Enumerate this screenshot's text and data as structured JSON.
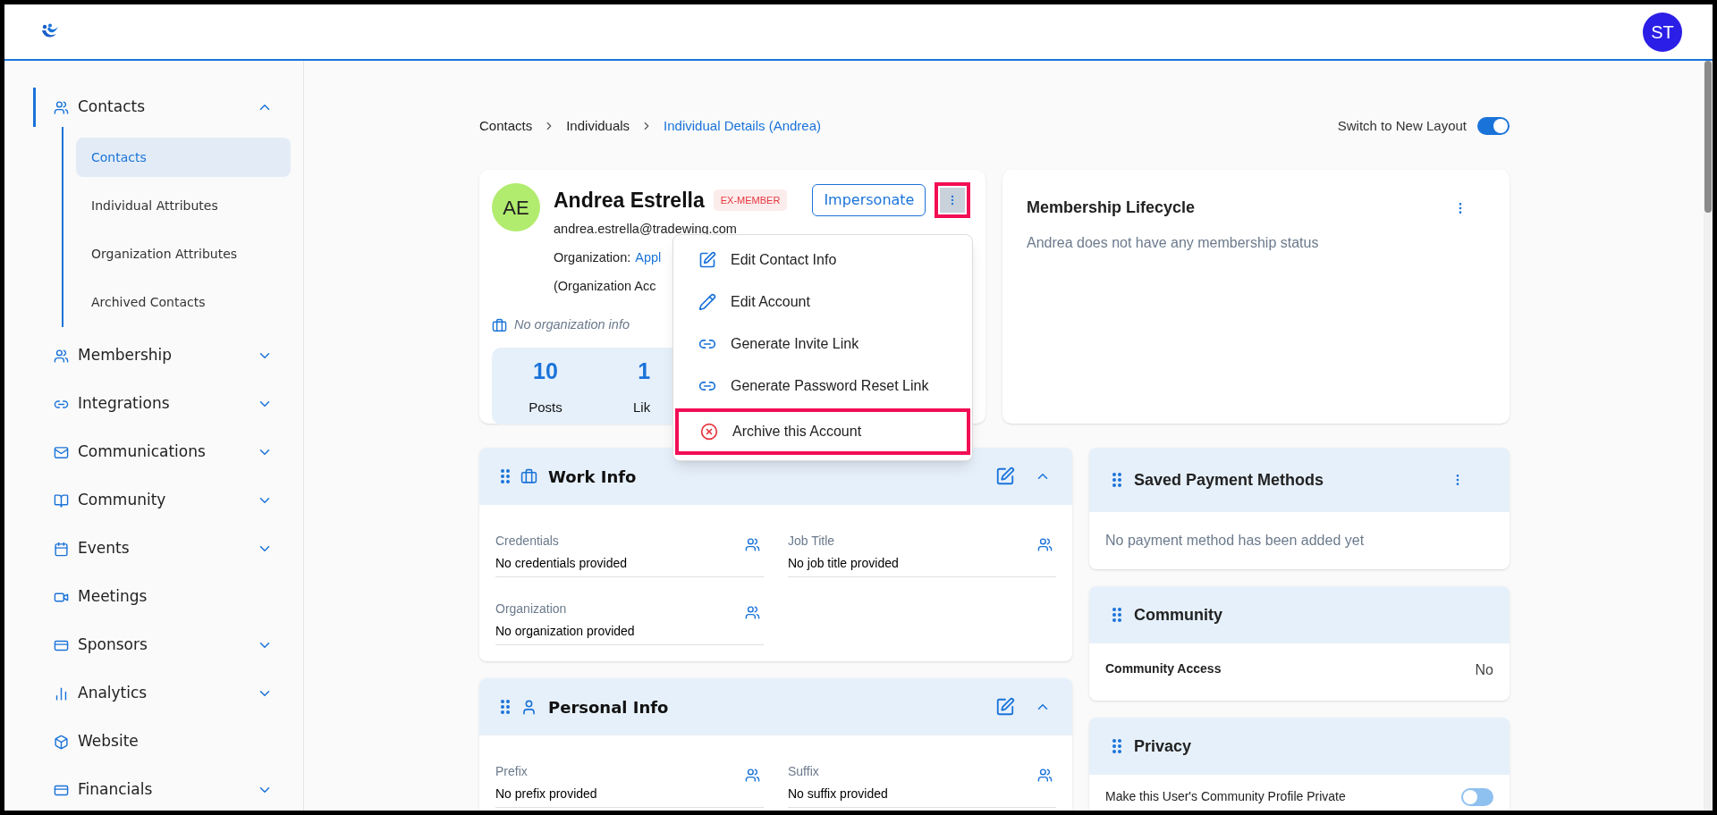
{
  "header": {
    "avatar": "ST"
  },
  "sidebar": {
    "items": [
      {
        "label": "Contacts",
        "kind": "group",
        "expanded": true,
        "active": true,
        "children": [
          {
            "label": "Contacts",
            "selected": true
          },
          {
            "label": "Individual Attributes",
            "selected": false
          },
          {
            "label": "Organization Attributes",
            "selected": false
          },
          {
            "label": "Archived Contacts",
            "selected": false
          }
        ]
      },
      {
        "label": "Membership",
        "kind": "group",
        "expanded": false,
        "active": false
      },
      {
        "label": "Integrations",
        "kind": "group",
        "expanded": false,
        "active": false
      },
      {
        "label": "Communications",
        "kind": "group",
        "expanded": false,
        "active": false
      },
      {
        "label": "Community",
        "kind": "group",
        "expanded": false,
        "active": false
      },
      {
        "label": "Events",
        "kind": "group",
        "expanded": false,
        "active": false
      },
      {
        "label": "Meetings",
        "kind": "link",
        "active": false
      },
      {
        "label": "Sponsors",
        "kind": "group",
        "expanded": false,
        "active": false
      },
      {
        "label": "Analytics",
        "kind": "group",
        "expanded": false,
        "active": false
      },
      {
        "label": "Website",
        "kind": "link",
        "active": false
      },
      {
        "label": "Financials",
        "kind": "group",
        "expanded": false,
        "active": false
      }
    ]
  },
  "breadcrumb": [
    "Contacts",
    "Individuals",
    "Individual Details (Andrea)"
  ],
  "layout_switch": {
    "label": "Switch to New Layout",
    "on": true
  },
  "profile": {
    "initials": "AE",
    "name": "Andrea Estrella",
    "badge": "EX-MEMBER",
    "email": "andrea.estrella@tradewing.com",
    "organization_label": "Organization:",
    "organization_link": "Appl",
    "organization_note": "(Organization Acc",
    "impersonate": "Impersonate",
    "more_highlighted": true,
    "no_org": "No organization info",
    "stats": [
      {
        "value": "10",
        "label": "Posts"
      },
      {
        "value": "1",
        "label": "Lik"
      }
    ]
  },
  "actions_menu": [
    {
      "label": "Edit Contact Info",
      "kind": "edit",
      "highlighted": false
    },
    {
      "label": "Edit Account",
      "kind": "pencil",
      "highlighted": false
    },
    {
      "label": "Generate Invite Link",
      "kind": "link",
      "highlighted": false
    },
    {
      "label": "Generate Password Reset Link",
      "kind": "link",
      "highlighted": false
    },
    {
      "label": "Archive this Account",
      "kind": "danger",
      "highlighted": true
    }
  ],
  "membership": {
    "title": "Membership Lifecycle",
    "text": "Andrea does not have any membership status"
  },
  "work_info": {
    "title": "Work Info",
    "fields": [
      {
        "label": "Credentials",
        "value": "No credentials provided"
      },
      {
        "label": "Job Title",
        "value": "No job title provided"
      },
      {
        "label": "Organization",
        "value": "No organization provided"
      }
    ]
  },
  "personal_info": {
    "title": "Personal Info",
    "fields": [
      {
        "label": "Prefix",
        "value": "No prefix provided"
      },
      {
        "label": "Suffix",
        "value": "No suffix provided"
      }
    ]
  },
  "payment": {
    "title": "Saved Payment Methods",
    "text": "No payment method has been added yet"
  },
  "community": {
    "title": "Community",
    "label": "Community Access",
    "value": "No"
  },
  "privacy": {
    "title": "Privacy",
    "label": "Make this User's Community Profile Private",
    "on": false
  }
}
